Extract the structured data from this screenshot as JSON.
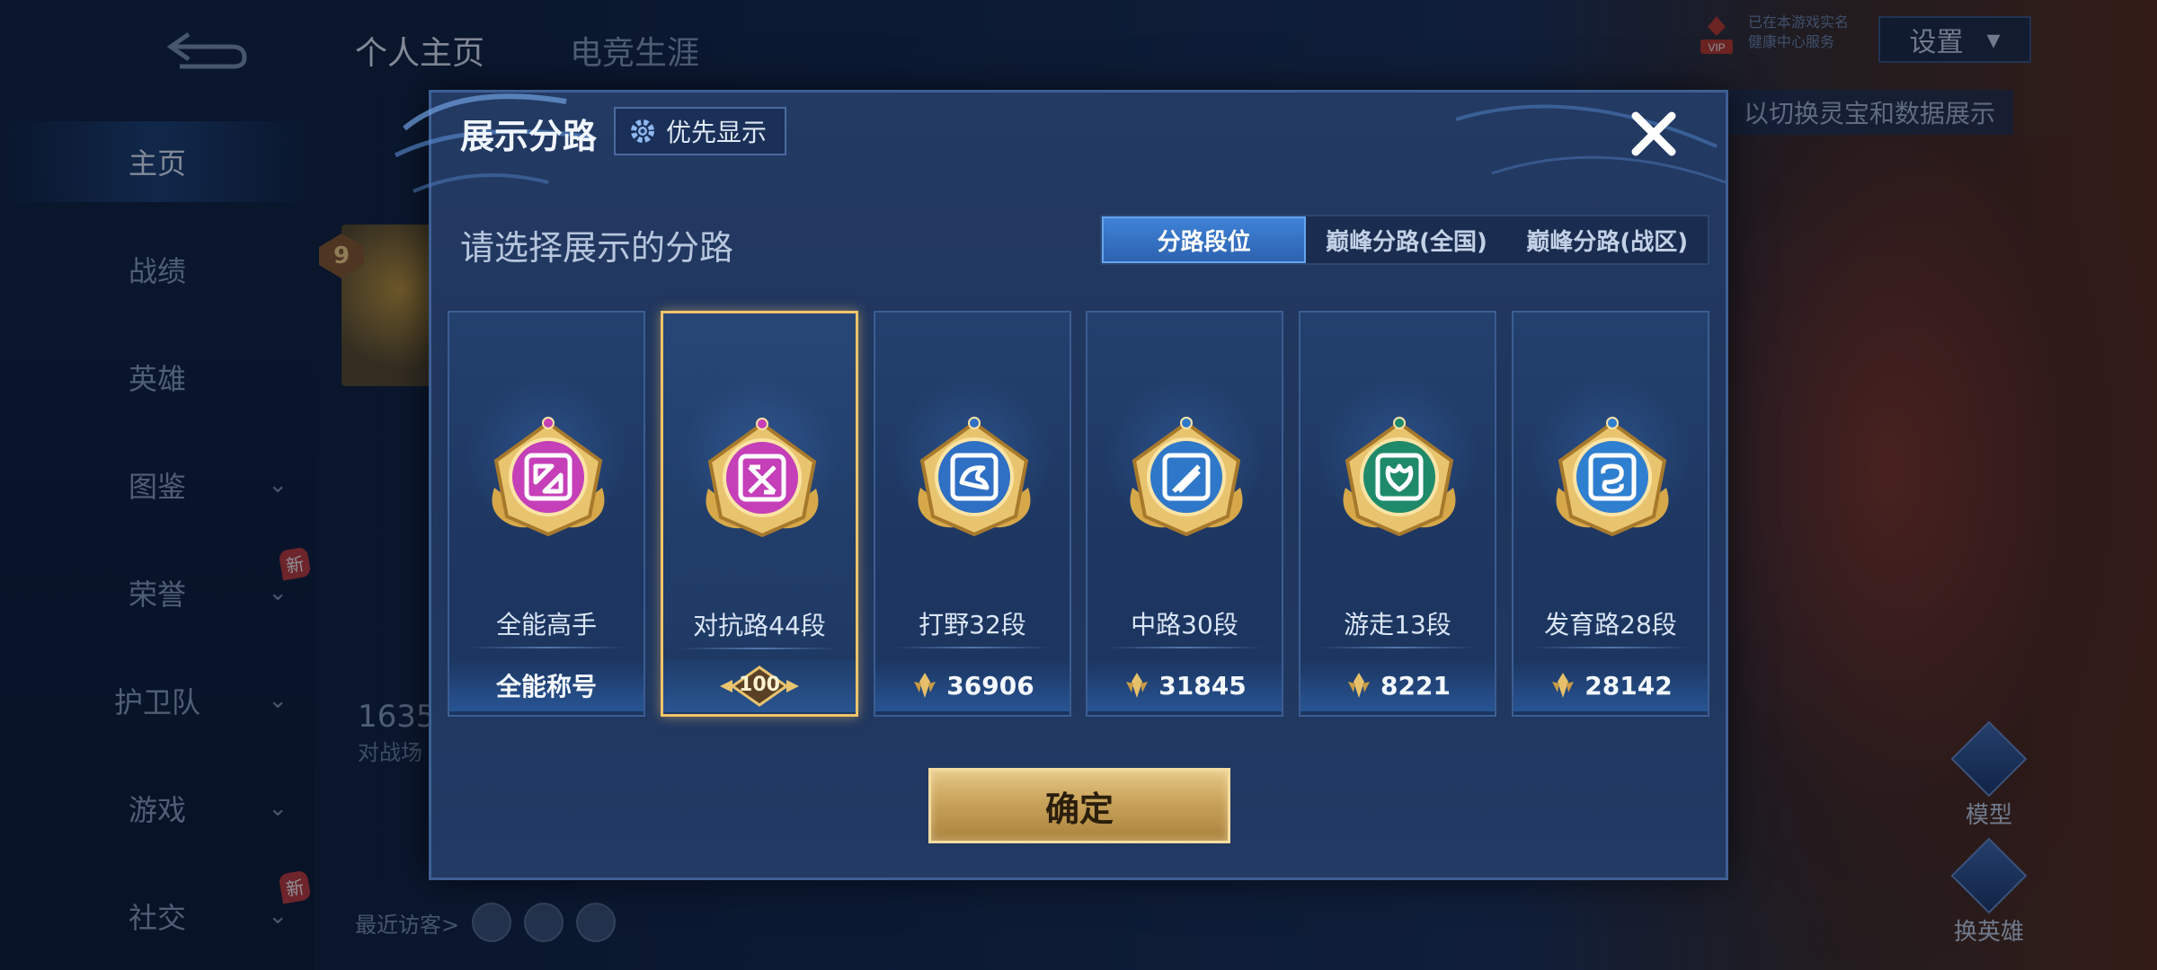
{
  "background": {
    "top_tabs": [
      "个人主页",
      "电竞生涯"
    ],
    "settings_label": "设置",
    "vip_label": "VIP",
    "vip_text": [
      "已在本游戏实名",
      "健康中心服务"
    ],
    "hint": "以切换灵宝和数据展示",
    "nav": [
      {
        "label": "主页",
        "active": true,
        "chevron": false,
        "badge": ""
      },
      {
        "label": "战绩",
        "active": false,
        "chevron": false,
        "badge": ""
      },
      {
        "label": "英雄",
        "active": false,
        "chevron": false,
        "badge": ""
      },
      {
        "label": "图鉴",
        "active": false,
        "chevron": true,
        "badge": ""
      },
      {
        "label": "荣誉",
        "active": false,
        "chevron": true,
        "badge": "新"
      },
      {
        "label": "护卫队",
        "active": false,
        "chevron": true,
        "badge": ""
      },
      {
        "label": "游戏",
        "active": false,
        "chevron": true,
        "badge": ""
      },
      {
        "label": "社交",
        "active": false,
        "chevron": true,
        "badge": "新"
      }
    ],
    "level": "9",
    "stat_number": "1635",
    "stat_label": "对战场",
    "visitors_label": "最近访客>",
    "right_buttons": [
      "模型",
      "换英雄"
    ]
  },
  "modal": {
    "title": "展示分路",
    "priority_label": "优先显示",
    "subtitle": "请选择展示的分路",
    "tabs": [
      {
        "label": "分路段位",
        "active": true
      },
      {
        "label": "巅峰分路(全国)",
        "active": false
      },
      {
        "label": "巅峰分路(战区)",
        "active": false
      }
    ],
    "lanes": [
      {
        "name": "全能高手",
        "score": "全能称号",
        "emblem_color": "#c53fb8",
        "icon": "all-round-emblem-icon",
        "selected": false,
        "score_type": "text"
      },
      {
        "name": "对抗路44段",
        "score": "100",
        "emblem_color": "#c53fb8",
        "icon": "clash-lane-emblem-icon",
        "selected": true,
        "score_type": "badge"
      },
      {
        "name": "打野32段",
        "score": "36906",
        "emblem_color": "#2f6fc4",
        "icon": "jungle-emblem-icon",
        "selected": false,
        "score_type": "points"
      },
      {
        "name": "中路30段",
        "score": "31845",
        "emblem_color": "#2f78c9",
        "icon": "mid-lane-emblem-icon",
        "selected": false,
        "score_type": "points"
      },
      {
        "name": "游走13段",
        "score": "8221",
        "emblem_color": "#1f8a6a",
        "icon": "roam-emblem-icon",
        "selected": false,
        "score_type": "points"
      },
      {
        "name": "发育路28段",
        "score": "28142",
        "emblem_color": "#2f7fd0",
        "icon": "farm-lane-emblem-icon",
        "selected": false,
        "score_type": "points"
      }
    ],
    "confirm_label": "确定"
  },
  "colors": {
    "accent_gold": "#f2c46a",
    "tab_active": "#3f82d6",
    "modal_bg": "#223a64"
  }
}
